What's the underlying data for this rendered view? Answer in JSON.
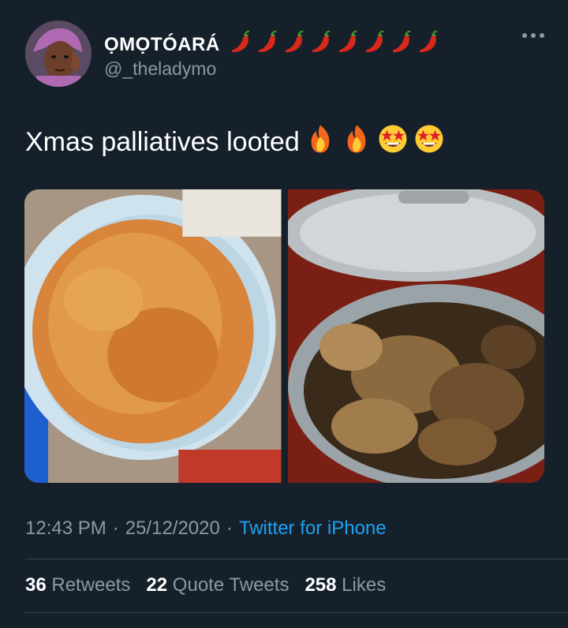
{
  "author": {
    "display_name": "ỌMỌTÓARÁ",
    "handle": "@_theladymo",
    "name_emojis": [
      "chili-pepper",
      "chili-pepper",
      "chili-pepper",
      "chili-pepper",
      "chili-pepper",
      "chili-pepper",
      "chili-pepper",
      "chili-pepper"
    ]
  },
  "tweet": {
    "text": "Xmas palliatives looted",
    "emojis": [
      "fire",
      "fire",
      "star-struck-face",
      "star-struck-face"
    ]
  },
  "media": [
    {
      "name": "jollof-rice-photo"
    },
    {
      "name": "cooked-meat-pot-photo"
    }
  ],
  "meta": {
    "time": "12:43 PM",
    "separator": "·",
    "date": "25/12/2020",
    "source": "Twitter for iPhone"
  },
  "stats": {
    "retweets_count": "36",
    "retweets_label": "Retweets",
    "quotes_count": "22",
    "quotes_label": "Quote Tweets",
    "likes_count": "258",
    "likes_label": "Likes"
  },
  "colors": {
    "background": "#15202b",
    "secondary_text": "#8899a6",
    "link": "#1da1f2",
    "divider": "#38444d"
  }
}
